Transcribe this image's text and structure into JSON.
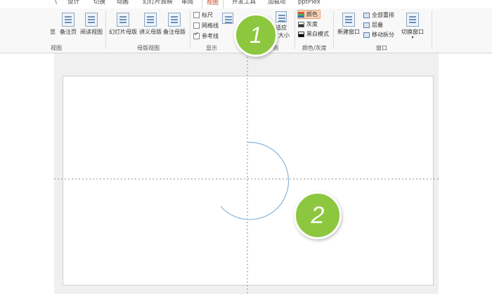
{
  "tabs": [
    "设计",
    "切换",
    "动画",
    "幻灯片放映",
    "审阅",
    "视图",
    "开发工具",
    "加载项",
    "pptPlex"
  ],
  "active_tab": "视图",
  "ribbon": {
    "presentation_views": {
      "partial_label": "览",
      "notes_page": "备注页",
      "reading_view": "阅读视图",
      "group_label": "视图"
    },
    "master_views": {
      "slide_master": "幻灯片母版",
      "handout_master": "讲义母版",
      "notes_master": "备注母版",
      "group_label": "母版视图"
    },
    "show": {
      "ruler": "标尺",
      "gridlines": "网格线",
      "guides": "参考线",
      "group_label": "显示"
    },
    "zoom": {
      "fit_line1": "适应",
      "fit_line2": "口大小",
      "group_label": "例"
    },
    "color": {
      "color": "颜色",
      "grayscale": "灰度",
      "black_white": "黑白模式",
      "group_label": "颜色/灰度"
    },
    "window": {
      "new_window": "新建窗口",
      "arrange_all": "全部重排",
      "cascade": "层叠",
      "move_split": "移动拆分",
      "switch_windows": "切换窗口",
      "group_label": "窗口"
    }
  },
  "checkboxes": {
    "ruler": false,
    "gridlines": false,
    "guides": true
  },
  "badges": [
    "1",
    "2"
  ],
  "colors": {
    "accent_tab": "#c43e1c",
    "badge": "#8dc73f",
    "arc": "#8ab4d8",
    "guide": "#8c8c8c"
  }
}
